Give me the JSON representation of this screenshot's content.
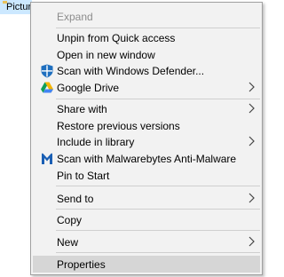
{
  "background": {
    "folder_label": "Pictures"
  },
  "menu": {
    "items": [
      {
        "label": "Expand"
      },
      {
        "label": "Unpin from Quick access"
      },
      {
        "label": "Open in new window"
      },
      {
        "label": "Scan with Windows Defender...",
        "icon": "windows-defender-shield"
      },
      {
        "label": "Google Drive",
        "icon": "google-drive"
      },
      {
        "label": "Share with"
      },
      {
        "label": "Restore previous versions"
      },
      {
        "label": "Include in library"
      },
      {
        "label": "Scan with Malwarebytes Anti-Malware",
        "icon": "malwarebytes"
      },
      {
        "label": "Pin to Start"
      },
      {
        "label": "Send to"
      },
      {
        "label": "Copy"
      },
      {
        "label": "New"
      },
      {
        "label": "Properties"
      }
    ]
  },
  "colors": {
    "menu_bg": "#f2f2f2",
    "highlight": "#d6d6d6",
    "disabled_text": "#8d8d8d",
    "selection_bg": "#cce8ff"
  }
}
